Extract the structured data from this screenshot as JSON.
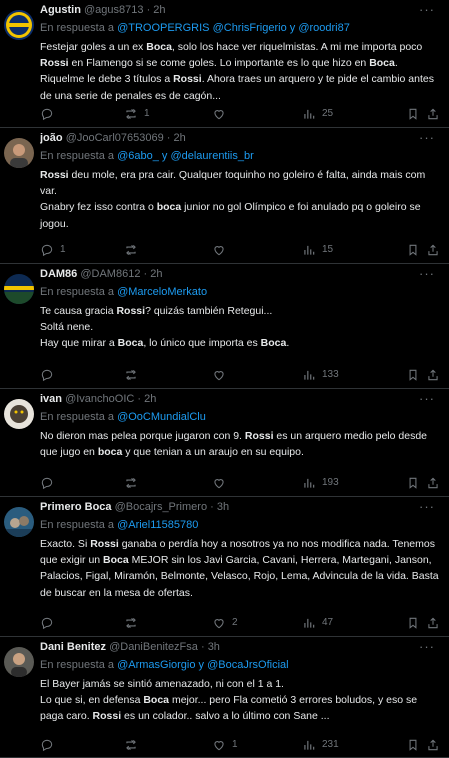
{
  "labels": {
    "replying_to": "En respuesta a",
    "and": "y"
  },
  "icons": {
    "reply": "reply-icon",
    "retweet": "retweet-icon",
    "like": "heart-icon",
    "views": "views-icon",
    "more": "more-icon"
  },
  "colors": {
    "background": "#000000",
    "text": "#e7e9ea",
    "muted": "#71767b",
    "mention": "#1d9bf0",
    "divider": "#2f3336"
  },
  "tweets": [
    {
      "name": "Agustin",
      "handle": "@agus8713",
      "time": "2h",
      "reply_to": [
        "@TROOPERGRIS",
        "@ChrisFrigerio",
        "@roodri87"
      ],
      "text": [
        [
          [
            "Festejar goles a un ex ",
            false
          ],
          [
            "Boca",
            true
          ],
          [
            ", solo los hace ver riquelmistas. A mi me importa poco ",
            false
          ],
          [
            "Rossi",
            true
          ],
          [
            " en Flamengo si se come goles. Lo importante es lo que hizo en ",
            false
          ],
          [
            "Boca",
            true
          ],
          [
            ". Riquelme le debe 3 títulos a ",
            false
          ],
          [
            "Rossi",
            true
          ],
          [
            ". Ahora traes un arquero y te pide el cambio antes de una serie de penales es de cagón...",
            false
          ]
        ]
      ],
      "replies": "",
      "retweets": "1",
      "likes": "",
      "views": "25"
    },
    {
      "name": "joão",
      "handle": "@JooCarl07653069",
      "time": "2h",
      "reply_to": [
        "@6abo_",
        "@delaurentiis_br"
      ],
      "text": [
        [
          [
            "Rossi",
            true
          ],
          [
            " deu mole, era pra cair. Qualquer toquinho no goleiro é falta, ainda mais com var.",
            false
          ]
        ],
        [
          [
            "Gnabry fez isso contra o ",
            false
          ],
          [
            "boca",
            true
          ],
          [
            " junior no gol Olímpico e foi anulado pq o goleiro se jogou.",
            false
          ]
        ]
      ],
      "replies": "1",
      "retweets": "",
      "likes": "",
      "views": "15"
    },
    {
      "name": "DAM86",
      "handle": "@DAM8612",
      "time": "2h",
      "reply_to": [
        "@MarceloMerkato"
      ],
      "text": [
        [
          [
            "Te causa gracia ",
            false
          ],
          [
            "Rossi",
            true
          ],
          [
            "? quizás también Retegui...",
            false
          ]
        ],
        [
          [
            "Soltá nene.",
            false
          ]
        ],
        [
          [
            "Hay que mirar a ",
            false
          ],
          [
            "Boca",
            true
          ],
          [
            ", lo único que importa es ",
            false
          ],
          [
            "Boca",
            true
          ],
          [
            ".",
            false
          ]
        ]
      ],
      "replies": "",
      "retweets": "",
      "likes": "",
      "views": "133"
    },
    {
      "name": "ivan",
      "handle": "@IvanchoOIC",
      "time": "2h",
      "reply_to": [
        "@OoCMundialClu"
      ],
      "text": [
        [
          [
            "No dieron mas pelea porque jugaron con 9. ",
            false
          ],
          [
            "Rossi",
            true
          ],
          [
            " es un arquero medio pelo desde que jugo en ",
            false
          ],
          [
            "boca",
            true
          ],
          [
            " y que tenian a un araujo en su equipo.",
            false
          ]
        ]
      ],
      "replies": "",
      "retweets": "",
      "likes": "",
      "views": "193"
    },
    {
      "name": "Primero Boca",
      "handle": "@Bocajrs_Primero",
      "time": "3h",
      "reply_to": [
        "@Ariel11585780"
      ],
      "text": [
        [
          [
            "Exacto. Si ",
            false
          ],
          [
            "Rossi",
            true
          ],
          [
            " ganaba o perdía hoy a nosotros ya no nos modifica nada. Tenemos que exigir un ",
            false
          ],
          [
            "Boca",
            true
          ],
          [
            " MEJOR sin los Javi Garcia, Cavani, Herrera, Martegani, Janson, Palacios, Figal, Miramón, Belmonte, Velasco, Rojo, Lema, Advincula de la vida. Basta de buscar en la mesa de ofertas.",
            false
          ]
        ]
      ],
      "replies": "",
      "retweets": "",
      "likes": "2",
      "views": "47"
    },
    {
      "name": "Dani Benitez",
      "handle": "@DaniBenitezFsa",
      "time": "3h",
      "reply_to": [
        "@ArmasGiorgio",
        "@BocaJrsOficial"
      ],
      "text": [
        [
          [
            "El Bayer jamás se sintió amenazado, ni con el 1 a 1.",
            false
          ]
        ],
        [
          [
            "Lo que si, en defensa ",
            false
          ],
          [
            "Boca",
            true
          ],
          [
            " mejor... pero Fla cometió 3 errores boludos, y eso se paga caro. ",
            false
          ],
          [
            "Rossi",
            true
          ],
          [
            " es un colador.. salvo a lo último con Sane ...",
            false
          ]
        ]
      ],
      "replies": "",
      "retweets": "",
      "likes": "1",
      "views": "231"
    }
  ]
}
